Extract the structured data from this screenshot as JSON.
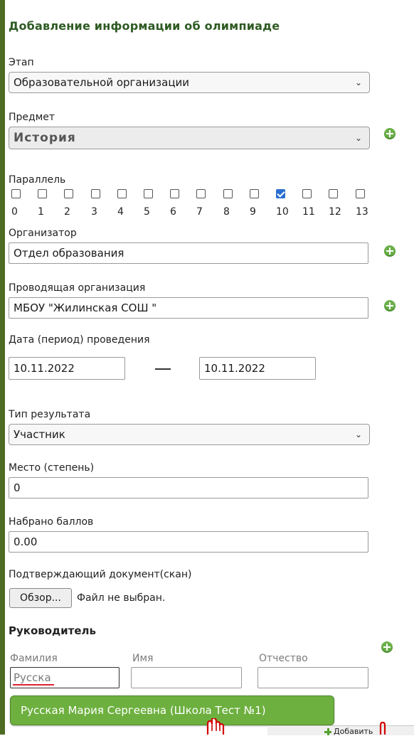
{
  "form": {
    "title": "Добавление информации об олимпиаде",
    "stage": {
      "label": "Этап",
      "value": "Образовательной организации"
    },
    "subject": {
      "label": "Предмет",
      "value": "История"
    },
    "grades": {
      "label": "Параллель",
      "items": [
        {
          "num": "0",
          "checked": false
        },
        {
          "num": "1",
          "checked": false
        },
        {
          "num": "2",
          "checked": false
        },
        {
          "num": "3",
          "checked": false
        },
        {
          "num": "4",
          "checked": false
        },
        {
          "num": "5",
          "checked": false
        },
        {
          "num": "6",
          "checked": false
        },
        {
          "num": "7",
          "checked": false
        },
        {
          "num": "8",
          "checked": false
        },
        {
          "num": "9",
          "checked": false
        },
        {
          "num": "10",
          "checked": true
        },
        {
          "num": "11",
          "checked": false
        },
        {
          "num": "12",
          "checked": false
        },
        {
          "num": "13",
          "checked": false
        }
      ]
    },
    "organizer": {
      "label": "Организатор",
      "value": "Отдел образования"
    },
    "host_org": {
      "label": "Проводящая организация",
      "value": "МБОУ \"Жилинская СОШ \""
    },
    "date": {
      "label": "Дата (период) проведения",
      "from": "10.11.2022",
      "dash": "—",
      "to": "10.11.2022"
    },
    "result_type": {
      "label": "Тип результата",
      "value": "Участник"
    },
    "place": {
      "label": "Место (степень)",
      "value": "0"
    },
    "score": {
      "label": "Набрано баллов",
      "value": "0.00"
    },
    "document": {
      "label": "Подтверждающий документ(скан)",
      "browse": "Обзор...",
      "none": "Файл не выбран."
    },
    "leader": {
      "section": "Руководитель",
      "surname_label": "Фамилия",
      "surname_value": "Русска",
      "name_label": "Имя",
      "name_value": "",
      "patronymic_label": "Отчество",
      "patronymic_value": ""
    },
    "suggestion": "Русская Мария Сергеевна (Школа Тест №1)",
    "add_link": "Добавить"
  },
  "colors": {
    "accent_green": "#6db03f",
    "title_green": "#2e5a23",
    "checkbox_blue": "#2a6fd0"
  }
}
